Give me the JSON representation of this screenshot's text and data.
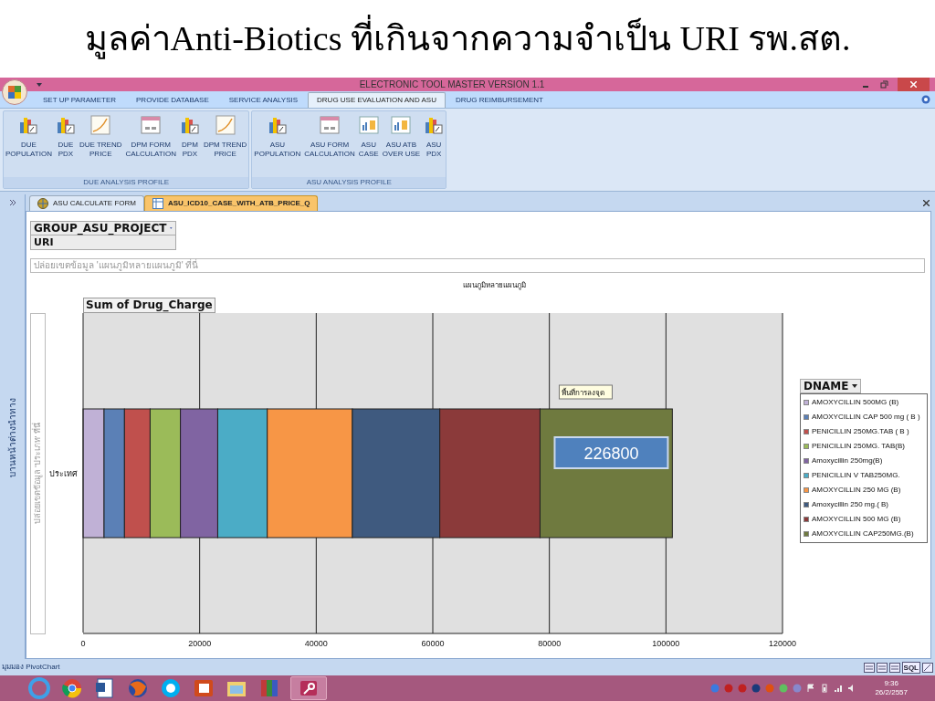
{
  "slide_title": "มูลค่าAnti-Biotics ที่เกินจากความจำเป็น URI รพ.สต.",
  "window": {
    "title": "ELECTRONIC TOOL MASTER VERSION 1.1"
  },
  "ribbon_tabs": [
    {
      "label": "SET UP PARAMETER",
      "selected": false
    },
    {
      "label": "PROVIDE DATABASE",
      "selected": false
    },
    {
      "label": "SERVICE ANALYSIS",
      "selected": false
    },
    {
      "label": "DRUG USE EVALUATION AND ASU",
      "selected": true
    },
    {
      "label": "DRUG REIMBURSEMENT",
      "selected": false
    }
  ],
  "ribbon_groups": [
    {
      "label": "DUE ANALYSIS PROFILE",
      "buttons": [
        {
          "lines": [
            "DUE",
            "POPULATION"
          ],
          "kind": "chart"
        },
        {
          "lines": [
            "DUE",
            "PDX"
          ],
          "kind": "chart"
        },
        {
          "lines": [
            "DUE TREND",
            "PRICE"
          ],
          "kind": "trend"
        },
        {
          "lines": [
            "DPM FORM",
            "CALCULATION"
          ],
          "kind": "form"
        },
        {
          "lines": [
            "DPM",
            "PDX"
          ],
          "kind": "chart"
        },
        {
          "lines": [
            "DPM TREND",
            "PRICE"
          ],
          "kind": "trend"
        }
      ]
    },
    {
      "label": "ASU ANALYSIS PROFILE",
      "buttons": [
        {
          "lines": [
            "ASU",
            "POPULATION"
          ],
          "kind": "chart"
        },
        {
          "lines": [
            "ASU FORM",
            "CALCULATION"
          ],
          "kind": "form"
        },
        {
          "lines": [
            "ASU",
            "CASE"
          ],
          "kind": "report"
        },
        {
          "lines": [
            "ASU ATB",
            "OVER USE"
          ],
          "kind": "report"
        },
        {
          "lines": [
            "ASU",
            "PDX"
          ],
          "kind": "chart"
        }
      ]
    }
  ],
  "nav_pane": {
    "label": "บานหน้าต่างนำทาง"
  },
  "document_tabs": [
    {
      "label": "ASU CALCULATE FORM",
      "kind": "form",
      "selected": false
    },
    {
      "label": "ASU_ICD10_CASE_WITH_ATB_PRICE_Q",
      "kind": "query",
      "selected": true
    }
  ],
  "pivot": {
    "filter_field": "GROUP_ASU_PROJECT",
    "filter_value": "URI",
    "series_drop_zone": "ปล่อยเขตข้อมูล 'แผนภูมิหลายแผนภูมิ' ที่นี่",
    "data_field": "Sum of Drug_Charge",
    "category_drop_zone": "ปล่อยเขตข้อมูล 'ประเภท' ที่นี่",
    "legend_field": "DNAME",
    "tooltip": "พื้นที่การลงจุด",
    "callout": "226800",
    "chart_data": {
      "type": "bar",
      "orientation": "horizontal",
      "stacked": true,
      "grid": true,
      "title": "แผนภูมิหลายแผนภูมิ",
      "categories": [
        "ประเทศ"
      ],
      "xlim": [
        0,
        120000
      ],
      "xticks": [
        0,
        20000,
        40000,
        60000,
        80000,
        100000,
        120000
      ],
      "series": [
        {
          "name": "AMOXYCILLIN 500MG (B)",
          "color": "#c0b1d6",
          "values": [
            3600
          ]
        },
        {
          "name": "AMOXYCILLIN CAP 500 mg ( B )",
          "color": "#5b80b6",
          "values": [
            3500
          ]
        },
        {
          "name": "PENICILLIN 250MG.TAB ( B )",
          "color": "#c0504d",
          "values": [
            4400
          ]
        },
        {
          "name": "PENICILLIN 250MG. TAB(B)",
          "color": "#9bbb59",
          "values": [
            5200
          ]
        },
        {
          "name": "Amoxycillin 250mg(B)",
          "color": "#8064a2",
          "values": [
            6400
          ]
        },
        {
          "name": "PENICILLIN V TAB250MG.",
          "color": "#4bacc6",
          "values": [
            8500
          ]
        },
        {
          "name": "AMOXYCILLIN 250 MG (B)",
          "color": "#f79646",
          "values": [
            14600
          ]
        },
        {
          "name": "Amoxycillin 250 mg.( B)",
          "color": "#3f5a7f",
          "values": [
            15000
          ]
        },
        {
          "name": "AMOXYCILLIN 500 MG (B)",
          "color": "#8b3a3a",
          "values": [
            17200
          ]
        },
        {
          "name": "AMOXYCILLIN CAP250MG.(B)",
          "color": "#6f7a3f",
          "values": [
            22700
          ]
        }
      ]
    }
  },
  "status_bar": {
    "text": "มุมมอง PivotChart",
    "sql_label": "SQL"
  },
  "taskbar": {
    "time": "9:36",
    "date": "26/2/2557"
  }
}
